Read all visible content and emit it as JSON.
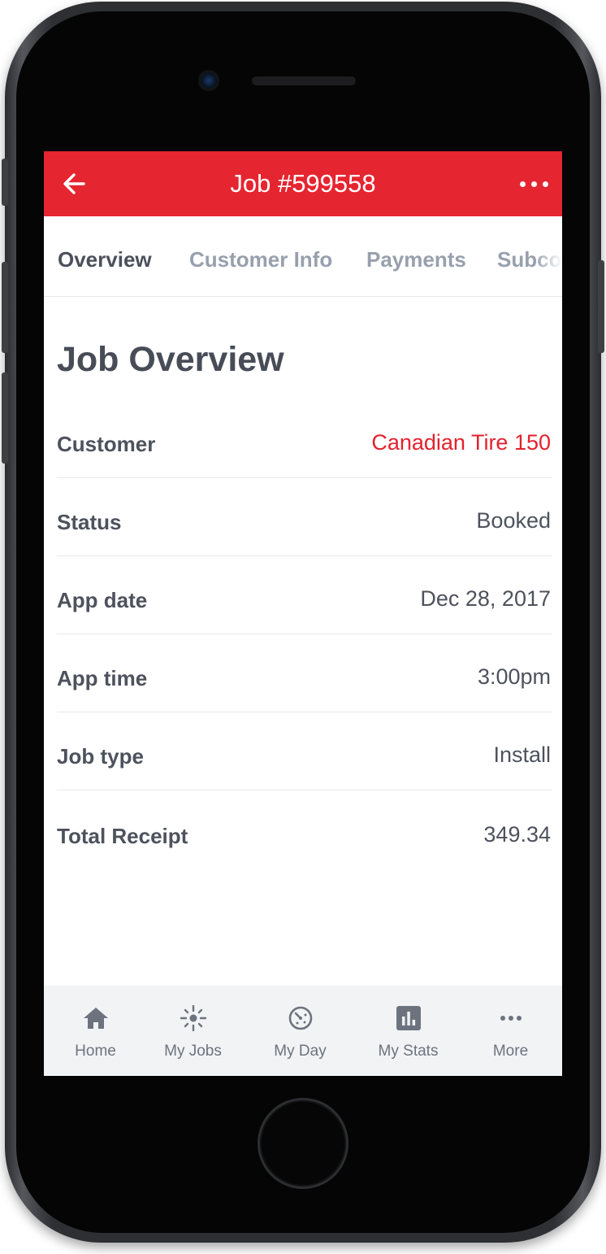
{
  "header": {
    "title": "Job #599558",
    "back_icon": "arrow-left-icon",
    "menu_icon": "more-horizontal-icon"
  },
  "tabs": [
    {
      "label": "Overview",
      "active": true
    },
    {
      "label": "Customer Info",
      "active": false
    },
    {
      "label": "Payments",
      "active": false
    },
    {
      "label": "Subcontractors",
      "active": false
    }
  ],
  "main": {
    "title": "Job Overview",
    "rows": [
      {
        "label": "Customer",
        "value": "Canadian Tire 150"
      },
      {
        "label": "Status",
        "value": "Booked"
      },
      {
        "label": "App date",
        "value": "Dec 28, 2017"
      },
      {
        "label": "App time",
        "value": "3:00pm"
      },
      {
        "label": "Job type",
        "value": "Install"
      },
      {
        "label": "Total Receipt",
        "value": "349.34"
      }
    ]
  },
  "bottom_nav": [
    {
      "label": "Home",
      "icon": "home-icon"
    },
    {
      "label": "My Jobs",
      "icon": "sparkle-icon"
    },
    {
      "label": "My Day",
      "icon": "clock-icon"
    },
    {
      "label": "My Stats",
      "icon": "bar-chart-icon"
    },
    {
      "label": "More",
      "icon": "more-horizontal-icon"
    }
  ],
  "colors": {
    "brand_red": "#e52530",
    "link_red": "#e3222d",
    "text": "#4d525d",
    "tab_inactive": "#98a0ad",
    "tabbar_bg": "#f2f3f5"
  }
}
